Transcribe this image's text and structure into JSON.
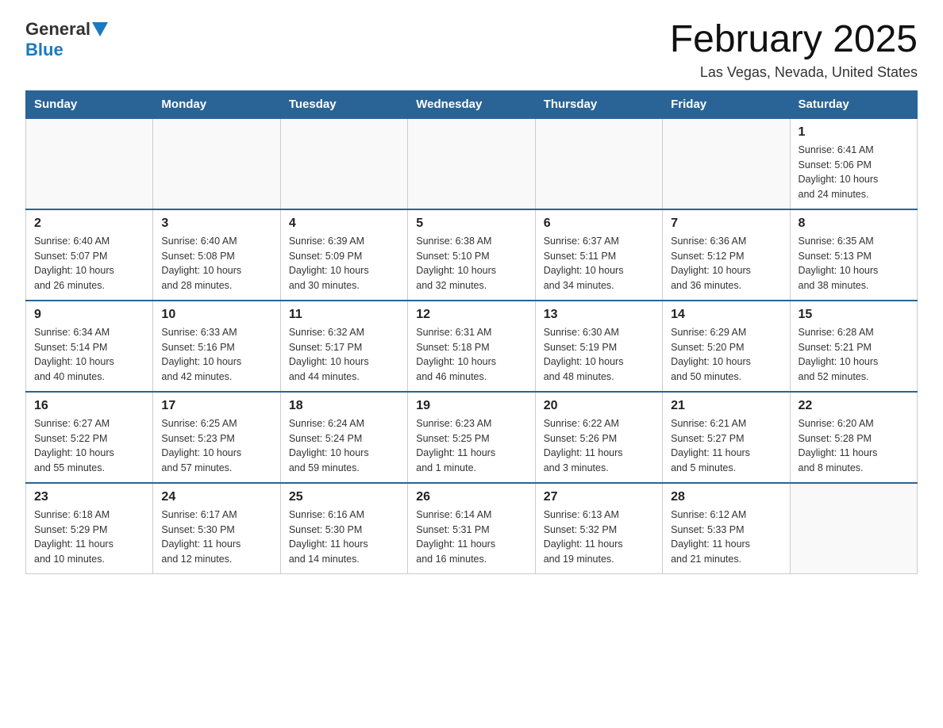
{
  "header": {
    "logo_general": "General",
    "logo_blue": "Blue",
    "month_title": "February 2025",
    "location": "Las Vegas, Nevada, United States"
  },
  "days_of_week": [
    "Sunday",
    "Monday",
    "Tuesday",
    "Wednesday",
    "Thursday",
    "Friday",
    "Saturday"
  ],
  "weeks": [
    {
      "days": [
        {
          "num": "",
          "info": ""
        },
        {
          "num": "",
          "info": ""
        },
        {
          "num": "",
          "info": ""
        },
        {
          "num": "",
          "info": ""
        },
        {
          "num": "",
          "info": ""
        },
        {
          "num": "",
          "info": ""
        },
        {
          "num": "1",
          "info": "Sunrise: 6:41 AM\nSunset: 5:06 PM\nDaylight: 10 hours\nand 24 minutes."
        }
      ]
    },
    {
      "days": [
        {
          "num": "2",
          "info": "Sunrise: 6:40 AM\nSunset: 5:07 PM\nDaylight: 10 hours\nand 26 minutes."
        },
        {
          "num": "3",
          "info": "Sunrise: 6:40 AM\nSunset: 5:08 PM\nDaylight: 10 hours\nand 28 minutes."
        },
        {
          "num": "4",
          "info": "Sunrise: 6:39 AM\nSunset: 5:09 PM\nDaylight: 10 hours\nand 30 minutes."
        },
        {
          "num": "5",
          "info": "Sunrise: 6:38 AM\nSunset: 5:10 PM\nDaylight: 10 hours\nand 32 minutes."
        },
        {
          "num": "6",
          "info": "Sunrise: 6:37 AM\nSunset: 5:11 PM\nDaylight: 10 hours\nand 34 minutes."
        },
        {
          "num": "7",
          "info": "Sunrise: 6:36 AM\nSunset: 5:12 PM\nDaylight: 10 hours\nand 36 minutes."
        },
        {
          "num": "8",
          "info": "Sunrise: 6:35 AM\nSunset: 5:13 PM\nDaylight: 10 hours\nand 38 minutes."
        }
      ]
    },
    {
      "days": [
        {
          "num": "9",
          "info": "Sunrise: 6:34 AM\nSunset: 5:14 PM\nDaylight: 10 hours\nand 40 minutes."
        },
        {
          "num": "10",
          "info": "Sunrise: 6:33 AM\nSunset: 5:16 PM\nDaylight: 10 hours\nand 42 minutes."
        },
        {
          "num": "11",
          "info": "Sunrise: 6:32 AM\nSunset: 5:17 PM\nDaylight: 10 hours\nand 44 minutes."
        },
        {
          "num": "12",
          "info": "Sunrise: 6:31 AM\nSunset: 5:18 PM\nDaylight: 10 hours\nand 46 minutes."
        },
        {
          "num": "13",
          "info": "Sunrise: 6:30 AM\nSunset: 5:19 PM\nDaylight: 10 hours\nand 48 minutes."
        },
        {
          "num": "14",
          "info": "Sunrise: 6:29 AM\nSunset: 5:20 PM\nDaylight: 10 hours\nand 50 minutes."
        },
        {
          "num": "15",
          "info": "Sunrise: 6:28 AM\nSunset: 5:21 PM\nDaylight: 10 hours\nand 52 minutes."
        }
      ]
    },
    {
      "days": [
        {
          "num": "16",
          "info": "Sunrise: 6:27 AM\nSunset: 5:22 PM\nDaylight: 10 hours\nand 55 minutes."
        },
        {
          "num": "17",
          "info": "Sunrise: 6:25 AM\nSunset: 5:23 PM\nDaylight: 10 hours\nand 57 minutes."
        },
        {
          "num": "18",
          "info": "Sunrise: 6:24 AM\nSunset: 5:24 PM\nDaylight: 10 hours\nand 59 minutes."
        },
        {
          "num": "19",
          "info": "Sunrise: 6:23 AM\nSunset: 5:25 PM\nDaylight: 11 hours\nand 1 minute."
        },
        {
          "num": "20",
          "info": "Sunrise: 6:22 AM\nSunset: 5:26 PM\nDaylight: 11 hours\nand 3 minutes."
        },
        {
          "num": "21",
          "info": "Sunrise: 6:21 AM\nSunset: 5:27 PM\nDaylight: 11 hours\nand 5 minutes."
        },
        {
          "num": "22",
          "info": "Sunrise: 6:20 AM\nSunset: 5:28 PM\nDaylight: 11 hours\nand 8 minutes."
        }
      ]
    },
    {
      "days": [
        {
          "num": "23",
          "info": "Sunrise: 6:18 AM\nSunset: 5:29 PM\nDaylight: 11 hours\nand 10 minutes."
        },
        {
          "num": "24",
          "info": "Sunrise: 6:17 AM\nSunset: 5:30 PM\nDaylight: 11 hours\nand 12 minutes."
        },
        {
          "num": "25",
          "info": "Sunrise: 6:16 AM\nSunset: 5:30 PM\nDaylight: 11 hours\nand 14 minutes."
        },
        {
          "num": "26",
          "info": "Sunrise: 6:14 AM\nSunset: 5:31 PM\nDaylight: 11 hours\nand 16 minutes."
        },
        {
          "num": "27",
          "info": "Sunrise: 6:13 AM\nSunset: 5:32 PM\nDaylight: 11 hours\nand 19 minutes."
        },
        {
          "num": "28",
          "info": "Sunrise: 6:12 AM\nSunset: 5:33 PM\nDaylight: 11 hours\nand 21 minutes."
        },
        {
          "num": "",
          "info": ""
        }
      ]
    }
  ]
}
